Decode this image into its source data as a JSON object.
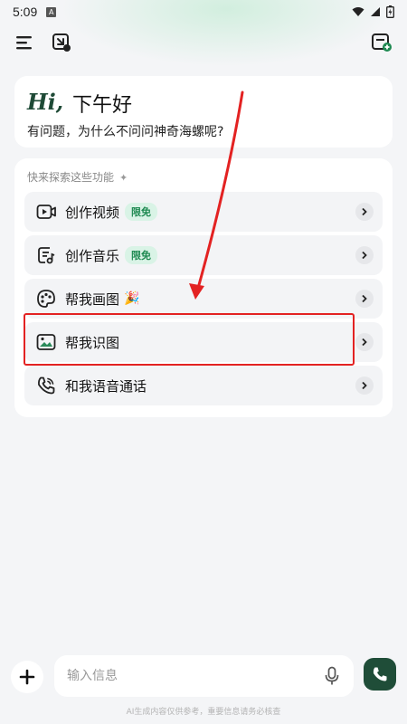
{
  "status": {
    "time": "5:09",
    "notif_letter": "A"
  },
  "greeting": {
    "hi": "Hi,",
    "rest": "下午好",
    "subtitle": "有问题，为什么不问问神奇海螺呢?"
  },
  "explore": {
    "title": "快来探索这些功能",
    "items": [
      {
        "label": "创作视频",
        "badge": "限免",
        "icon": "video-icon"
      },
      {
        "label": "创作音乐",
        "badge": "限免",
        "icon": "music-icon"
      },
      {
        "label": "帮我画图",
        "emoji": "🎉",
        "icon": "palette-icon"
      },
      {
        "label": "帮我识图",
        "icon": "image-icon"
      },
      {
        "label": "和我语音通话",
        "icon": "phone-icon"
      }
    ]
  },
  "input": {
    "placeholder": "输入信息"
  },
  "footer": {
    "disclaimer": "AI生成内容仅供参考，重要信息请务必核查"
  },
  "colors": {
    "brand_green": "#1f4d38",
    "badge_bg": "#d9f3e6",
    "badge_text": "#1f8a52",
    "annotation_red": "#e32222"
  }
}
